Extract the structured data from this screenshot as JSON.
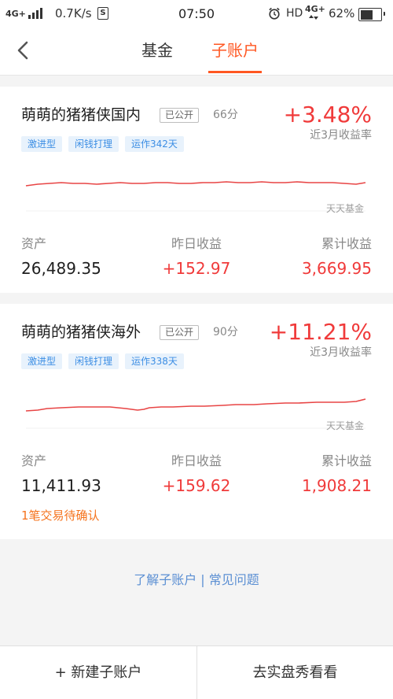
{
  "status_bar": {
    "network": "4G+",
    "signal_level": 4,
    "signal_max": 4,
    "speed": "0.7K/s",
    "app_icon_letter": "S",
    "time": "07:50",
    "hd": "HD",
    "network_right": "4G+",
    "battery_text": "62%",
    "battery_level": 62,
    "icons": {
      "signal": "signal-bars-icon",
      "app": "s-box-icon",
      "alarm": "alarm-clock-icon",
      "data_activity": "up-down-arrows-icon",
      "battery": "battery-icon"
    }
  },
  "header": {
    "back_icon": "chevron-left-icon",
    "tabs": [
      {
        "label": "基金",
        "active": false
      },
      {
        "label": "子账户",
        "active": true
      }
    ]
  },
  "accounts": [
    {
      "name": "萌萌的猪猪侠国内",
      "visibility_badge": "已公开",
      "score": "66分",
      "return": "+3.48%",
      "return_label": "近3月收益率",
      "tags": [
        "激进型",
        "闲钱打理",
        "运作342天"
      ],
      "chart_watermark": "天天基金",
      "stats": [
        {
          "label": "资产",
          "value": "26,489.35"
        },
        {
          "label": "昨日收益",
          "value": "+152.97"
        },
        {
          "label": "累计收益",
          "value": "3,669.95"
        }
      ]
    },
    {
      "name": "萌萌的猪猪侠海外",
      "visibility_badge": "已公开",
      "score": "90分",
      "return": "+11.21%",
      "return_label": "近3月收益率",
      "tags": [
        "激进型",
        "闲钱打理",
        "运作338天"
      ],
      "chart_watermark": "天天基金",
      "stats": [
        {
          "label": "资产",
          "value": "11,411.93"
        },
        {
          "label": "昨日收益",
          "value": "+159.62"
        },
        {
          "label": "累计收益",
          "value": "1,908.21"
        }
      ],
      "pending": "1笔交易待确认"
    }
  ],
  "links": {
    "about": "了解子账户",
    "separator": "|",
    "faq": "常见问题"
  },
  "bottom_bar": {
    "new_account": "+ 新建子账户",
    "showcase": "去实盘秀看看"
  },
  "colors": {
    "accent": "#ff5722",
    "up": "#f03a3a",
    "link": "#5b8fd3",
    "tag_bg": "#e8f2fc",
    "tag_text": "#3c8ee4",
    "pending": "#f5731d",
    "line": "#e84545"
  }
}
